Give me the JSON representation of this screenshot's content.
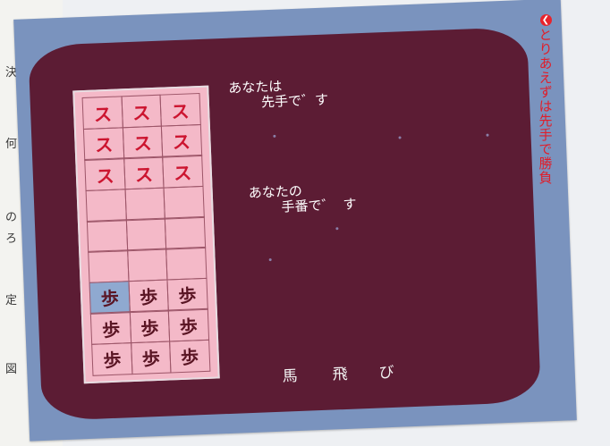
{
  "left_column_text": [
    "決",
    "何",
    "の",
    "ろ",
    "定",
    "図"
  ],
  "game": {
    "message_1": "あなたは\n    先手で゛す",
    "message_2": "あなたの\n    手番で゛ す",
    "menu": [
      "馬",
      "飛",
      "び"
    ],
    "board": {
      "enemy_piece": "ス",
      "player_piece": "歩",
      "rows": [
        [
          "ス",
          "ス",
          "ス"
        ],
        [
          "ス",
          "ス",
          "ス"
        ],
        [
          "ス",
          "ス",
          "ス"
        ],
        [
          "",
          "",
          ""
        ],
        [
          "",
          "",
          ""
        ],
        [
          "",
          "",
          ""
        ],
        [
          "歩",
          "歩",
          "歩"
        ],
        [
          "歩",
          "歩",
          "歩"
        ],
        [
          "歩",
          "歩",
          "歩"
        ]
      ],
      "selected_cell": "row 7, column 1"
    }
  },
  "caption": {
    "icon": "left-arrow-circle-icon",
    "text": "とりあえずは先手で勝負"
  },
  "colors": {
    "screen": "#5c1c34",
    "frame": "#7a93be",
    "board": "#f4b9c8",
    "enemy_piece": "#cc1530",
    "caption": "#e01e2a"
  }
}
